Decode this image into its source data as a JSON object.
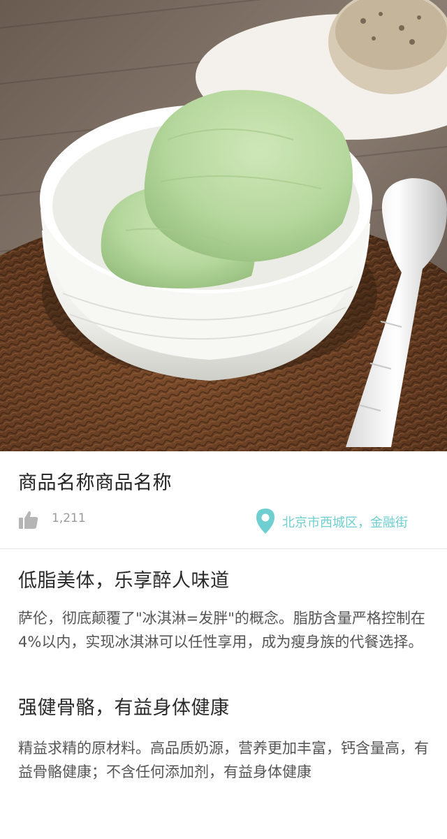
{
  "product": {
    "name": "商品名称商品名称",
    "likes": "1,211",
    "location": "北京市西城区，金融街"
  },
  "sections": [
    {
      "title": "低脂美体，乐享醉人味道",
      "body": "萨伦，彻底颠覆了\"冰淇淋=发胖\"的概念。脂肪含量严格控制在4%以内，实现冰淇淋可以任性享用，成为瘦身族的代餐选择。"
    },
    {
      "title": "强健骨骼，有益身体健康",
      "body": "精益求精的原材料。高品质奶源，营养更加丰富，钙含量高，有益骨骼健康；不含任何添加剂，有益身体健康"
    }
  ],
  "colors": {
    "accent": "#6fcfd0",
    "icon_gray": "#b5b5b5",
    "ice_cream": "#b5d99c"
  },
  "icons": {
    "like": "thumbs-up-icon",
    "location": "map-pin-icon"
  }
}
